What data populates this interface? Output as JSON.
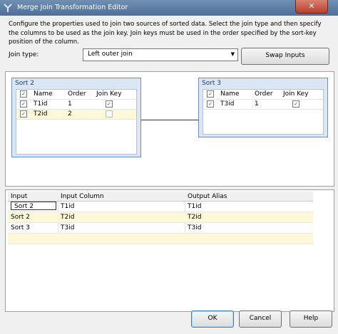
{
  "window": {
    "title": "Merge Join Transformation Editor",
    "close_glyph": "✕"
  },
  "description": "Configure the properties used to join two sources of sorted data. Select the join type and then specify the columns to be used as the join key. Join keys must be used in the order specified by the sort-key position of the column.",
  "join": {
    "label": "Join type:",
    "selected": "Left outer join",
    "swap_label": "Swap Inputs"
  },
  "inputs": [
    {
      "title": "Sort 2",
      "headers": {
        "name": "Name",
        "order": "Order",
        "key": "Join Key"
      },
      "rows": [
        {
          "name": "T1id",
          "order": "1",
          "selected": true,
          "join_key": true
        },
        {
          "name": "T2id",
          "order": "2",
          "selected": true,
          "join_key": false
        }
      ]
    },
    {
      "title": "Sort 3",
      "headers": {
        "name": "Name",
        "order": "Order",
        "key": "Join Key"
      },
      "rows": [
        {
          "name": "T3id",
          "order": "1",
          "selected": true,
          "join_key": true
        }
      ]
    }
  ],
  "output_table": {
    "headers": {
      "input": "Input",
      "column": "Input Column",
      "alias": "Output Alias"
    },
    "rows": [
      {
        "input": "Sort 2",
        "column": "T1id",
        "alias": "T1id"
      },
      {
        "input": "Sort 2",
        "column": "T2id",
        "alias": "T2id"
      },
      {
        "input": "Sort 3",
        "column": "T3id",
        "alias": "T3id"
      }
    ]
  },
  "buttons": {
    "ok": "OK",
    "cancel": "Cancel",
    "help": "Help"
  },
  "colors": {
    "title_bar": "#5a7ba3",
    "close": "#c7503c",
    "selected_row": "#fdf8d8"
  }
}
